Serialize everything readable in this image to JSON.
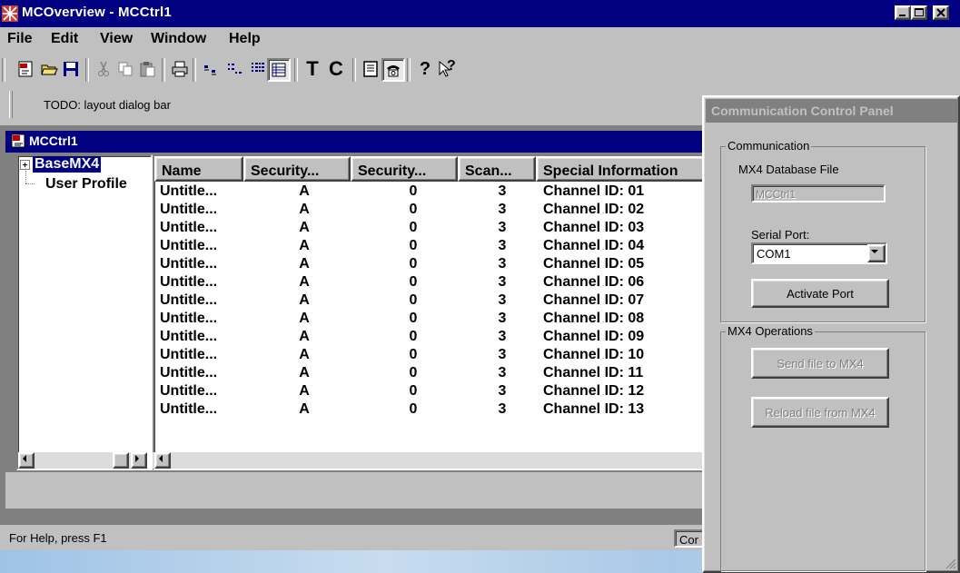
{
  "window": {
    "title": "MCOverview - MCCtrl1"
  },
  "menu": [
    "File",
    "Edit",
    "View",
    "Window",
    "Help"
  ],
  "toolbar": {
    "text_tool_t": "T",
    "text_tool_c": "C",
    "help_glyph": "?",
    "context_help_glyph": "?"
  },
  "dialog_bar": {
    "text": "TODO: layout dialog bar"
  },
  "child": {
    "title": "MCCtrl1"
  },
  "tree": {
    "items": [
      "BaseMX4",
      "User Profile"
    ]
  },
  "list": {
    "columns": [
      "Name",
      "Security...",
      "Security...",
      "Scan...",
      "Special Information"
    ],
    "rows": [
      [
        "Untitle...",
        "A",
        "0",
        "3",
        "Channel ID: 01"
      ],
      [
        "Untitle...",
        "A",
        "0",
        "3",
        "Channel ID: 02"
      ],
      [
        "Untitle...",
        "A",
        "0",
        "3",
        "Channel ID: 03"
      ],
      [
        "Untitle...",
        "A",
        "0",
        "3",
        "Channel ID: 04"
      ],
      [
        "Untitle...",
        "A",
        "0",
        "3",
        "Channel ID: 05"
      ],
      [
        "Untitle...",
        "A",
        "0",
        "3",
        "Channel ID: 06"
      ],
      [
        "Untitle...",
        "A",
        "0",
        "3",
        "Channel ID: 07"
      ],
      [
        "Untitle...",
        "A",
        "0",
        "3",
        "Channel ID: 08"
      ],
      [
        "Untitle...",
        "A",
        "0",
        "3",
        "Channel ID: 09"
      ],
      [
        "Untitle...",
        "A",
        "0",
        "3",
        "Channel ID: 10"
      ],
      [
        "Untitle...",
        "A",
        "0",
        "3",
        "Channel ID: 11"
      ],
      [
        "Untitle...",
        "A",
        "0",
        "3",
        "Channel ID: 12"
      ],
      [
        "Untitle...",
        "A",
        "0",
        "3",
        "Channel ID: 13"
      ]
    ]
  },
  "status": {
    "text": "For Help, press F1",
    "panel": "Cor"
  },
  "panel": {
    "title": "Communication Control Panel",
    "communication_group": "Communication",
    "db_file_label": "MX4 Database File",
    "db_file_value": "MCCtrl1",
    "serial_port_label": "Serial Port:",
    "serial_port_value": "COM1",
    "activate_button": "Activate Port",
    "operations_group": "MX4 Operations",
    "send_button": "Send file to MX4",
    "reload_button": "Reload file from MX4"
  },
  "colors": {
    "title_active": "#000080",
    "face": "#c0c0c0",
    "mdi": "#808080"
  }
}
